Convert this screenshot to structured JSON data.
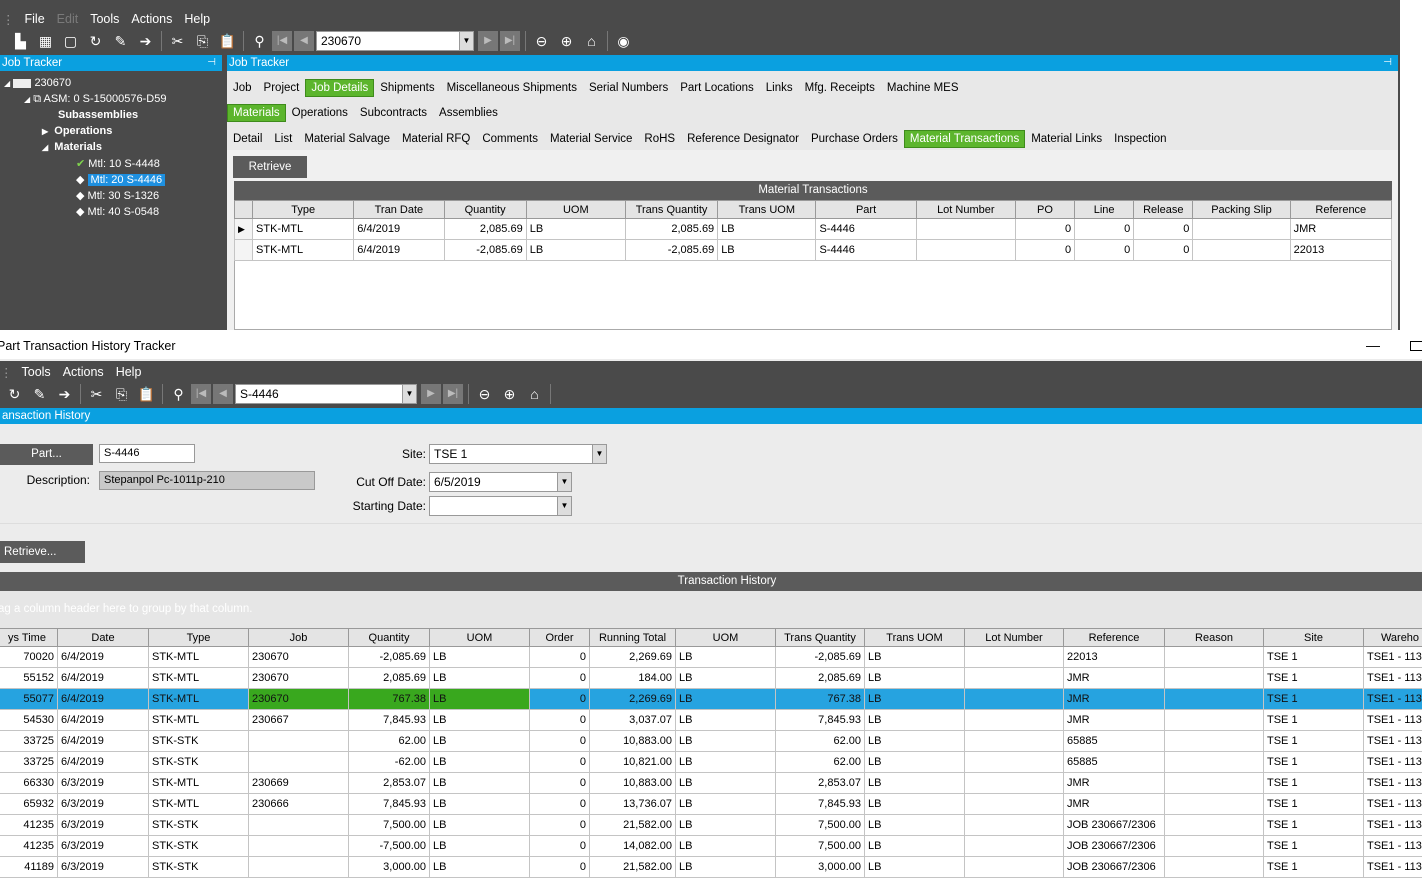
{
  "job_tracker": {
    "menu": {
      "file": "File",
      "edit": "Edit",
      "tools": "Tools",
      "actions": "Actions",
      "help": "Help"
    },
    "job_number": "230670",
    "left_pane_title": "Job Tracker",
    "right_pane_title": "Job Tracker",
    "tree": {
      "root": "230670",
      "asm": "ASM: 0 S-15000576-D59",
      "subassemblies": "Subassemblies",
      "operations": "Operations",
      "materials": "Materials",
      "items": [
        "Mtl: 10 S-4448",
        "Mtl: 20 S-4446",
        "Mtl: 30 S-1326",
        "Mtl: 40 S-0548"
      ]
    },
    "tabs1": [
      "Job",
      "Project",
      "Job Details",
      "Shipments",
      "Miscellaneous Shipments",
      "Serial Numbers",
      "Part Locations",
      "Links",
      "Mfg. Receipts",
      "Machine MES"
    ],
    "tabs2": [
      "Materials",
      "Operations",
      "Subcontracts",
      "Assemblies"
    ],
    "tabs3": [
      "Detail",
      "List",
      "Material Salvage",
      "Material RFQ",
      "Comments",
      "Material Service",
      "RoHS",
      "Reference Designator",
      "Purchase Orders",
      "Material Transactions",
      "Material Links",
      "Inspection"
    ],
    "retrieve": "Retrieve",
    "grid_title": "Material Transactions",
    "columns": [
      "Type",
      "Tran Date",
      "Quantity",
      "UOM",
      "Trans Quantity",
      "Trans UOM",
      "Part",
      "Lot Number",
      "PO",
      "Line",
      "Release",
      "Packing Slip",
      "Reference"
    ],
    "rows": [
      [
        "STK-MTL",
        "6/4/2019",
        "2,085.69",
        "LB",
        "2,085.69",
        "LB",
        "S-4446",
        "",
        "0",
        "0",
        "0",
        "",
        "JMR"
      ],
      [
        "STK-MTL",
        "6/4/2019",
        "-2,085.69",
        "LB",
        "-2,085.69",
        "LB",
        "S-4446",
        "",
        "0",
        "0",
        "0",
        "",
        "22013"
      ]
    ]
  },
  "part_tracker": {
    "title": "Part Transaction History Tracker",
    "menu": {
      "tools": "Tools",
      "actions": "Actions",
      "help": "Help"
    },
    "part_combo": "S-4446",
    "pane_title": "ansaction History",
    "part_button": "Part...",
    "part_value": "S-4446",
    "description_label": "Description:",
    "description_value": "Stepanpol Pc-1011p-210",
    "site_label": "Site:",
    "site_value": "TSE 1",
    "cutoff_label": "Cut Off Date:",
    "cutoff_value": "6/5/2019",
    "starting_label": "Starting Date:",
    "starting_value": "",
    "retrieve": "Retrieve...",
    "grid_title": "Transaction History",
    "group_hint": "ag a column header here to group by that column.",
    "columns": [
      "ys Time",
      "Date",
      "Type",
      "Job",
      "Quantity",
      "UOM",
      "Order",
      "Running Total",
      "UOM",
      "Trans Quantity",
      "Trans UOM",
      "Lot Number",
      "Reference",
      "Reason",
      "Site",
      "Wareho"
    ],
    "rows": [
      [
        "70020",
        "6/4/2019",
        "STK-MTL",
        "230670",
        "-2,085.69",
        "LB",
        "0",
        "2,269.69",
        "LB",
        "-2,085.69",
        "LB",
        "",
        "22013",
        "",
        "TSE 1",
        "TSE1 - 113"
      ],
      [
        "55152",
        "6/4/2019",
        "STK-MTL",
        "230670",
        "2,085.69",
        "LB",
        "0",
        "184.00",
        "LB",
        "2,085.69",
        "LB",
        "",
        "JMR",
        "",
        "TSE 1",
        "TSE1 - 113"
      ],
      [
        "55077",
        "6/4/2019",
        "STK-MTL",
        "230670",
        "767.38",
        "LB",
        "0",
        "2,269.69",
        "LB",
        "767.38",
        "LB",
        "",
        "JMR",
        "",
        "TSE 1",
        "TSE1 - 113"
      ],
      [
        "54530",
        "6/4/2019",
        "STK-MTL",
        "230667",
        "7,845.93",
        "LB",
        "0",
        "3,037.07",
        "LB",
        "7,845.93",
        "LB",
        "",
        "JMR",
        "",
        "TSE 1",
        "TSE1 - 113"
      ],
      [
        "33725",
        "6/4/2019",
        "STK-STK",
        "",
        "62.00",
        "LB",
        "0",
        "10,883.00",
        "LB",
        "62.00",
        "LB",
        "",
        "65885",
        "",
        "TSE 1",
        "TSE1 - 113"
      ],
      [
        "33725",
        "6/4/2019",
        "STK-STK",
        "",
        "-62.00",
        "LB",
        "0",
        "10,821.00",
        "LB",
        "62.00",
        "LB",
        "",
        "65885",
        "",
        "TSE 1",
        "TSE1 - 113"
      ],
      [
        "66330",
        "6/3/2019",
        "STK-MTL",
        "230669",
        "2,853.07",
        "LB",
        "0",
        "10,883.00",
        "LB",
        "2,853.07",
        "LB",
        "",
        "JMR",
        "",
        "TSE 1",
        "TSE1 - 113"
      ],
      [
        "65932",
        "6/3/2019",
        "STK-MTL",
        "230666",
        "7,845.93",
        "LB",
        "0",
        "13,736.07",
        "LB",
        "7,845.93",
        "LB",
        "",
        "JMR",
        "",
        "TSE 1",
        "TSE1 - 113"
      ],
      [
        "41235",
        "6/3/2019",
        "STK-STK",
        "",
        "7,500.00",
        "LB",
        "0",
        "21,582.00",
        "LB",
        "7,500.00",
        "LB",
        "",
        "JOB 230667/2306",
        "",
        "TSE 1",
        "TSE1 - 113"
      ],
      [
        "41235",
        "6/3/2019",
        "STK-STK",
        "",
        "-7,500.00",
        "LB",
        "0",
        "14,082.00",
        "LB",
        "7,500.00",
        "LB",
        "",
        "JOB 230667/2306",
        "",
        "TSE 1",
        "TSE1 - 113"
      ],
      [
        "41189",
        "6/3/2019",
        "STK-STK",
        "",
        "3,000.00",
        "LB",
        "0",
        "21,582.00",
        "LB",
        "3,000.00",
        "LB",
        "",
        "JOB 230667/2306",
        "",
        "TSE 1",
        "TSE1 - 113"
      ]
    ]
  }
}
